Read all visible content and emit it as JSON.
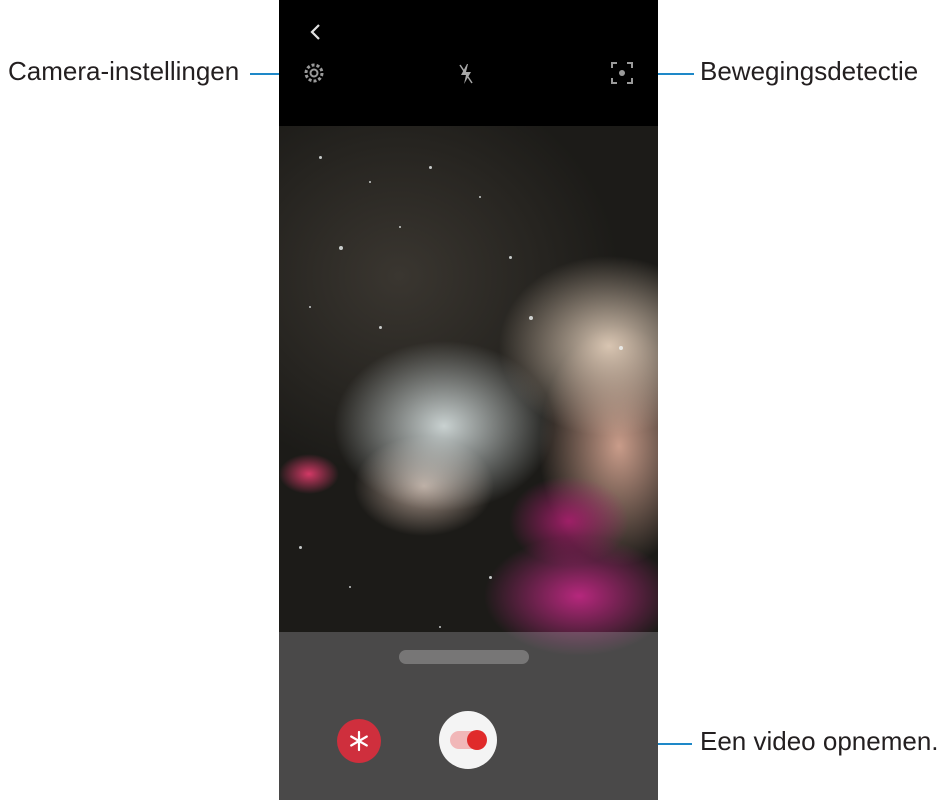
{
  "callouts": {
    "settings": "Camera-instellingen",
    "motion": "Bewegingsdetectie",
    "record": "Een video opnemen."
  },
  "icons": {
    "back": "chevron-left-icon",
    "settings": "gear-icon",
    "flash": "flash-off-icon",
    "motion": "motion-detection-icon",
    "effect": "snowflake-icon",
    "record": "record-toggle-icon"
  },
  "colors": {
    "leader_line": "#1e88c8",
    "effect_button": "#cf2f3d",
    "record_dot": "#e02a2a"
  }
}
